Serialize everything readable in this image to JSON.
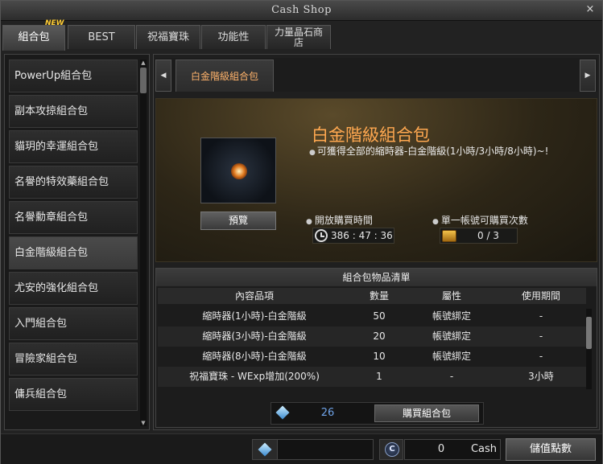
{
  "window": {
    "title": "Cash Shop",
    "close": "×"
  },
  "tabs": [
    {
      "label": "組合包",
      "badge": "NEW"
    },
    {
      "label": "BEST"
    },
    {
      "label": "祝福寶珠"
    },
    {
      "label": "功能性"
    },
    {
      "label_line1": "力量晶石商",
      "label_line2": "店"
    }
  ],
  "sidebar": {
    "items": [
      "PowerUp組合包",
      "副本攻掠組合包",
      "貓玥的幸運組合包",
      "名譽的特效藥組合包",
      "名譽勳章組合包",
      "白金階級組合包",
      "尤安的強化組合包",
      "入門組合包",
      "冒險家組合包",
      "傭兵組合包"
    ],
    "selected_index": 5
  },
  "subnav": {
    "left": "◀",
    "right": "▶",
    "tab": "白金階級組合包"
  },
  "product": {
    "title": "白金階級組合包",
    "description": "可獲得全部的縮時器-白金階級(1小時/3小時/8小時)~!",
    "preview_label": "預覽",
    "open_time_label": "開放購買時間",
    "open_time_value": "386 : 47 : 36",
    "purchase_limit_label": "單一帳號可購買次數",
    "purchase_limit_value": "0 / 3"
  },
  "item_list": {
    "title": "組合包物品清單",
    "headers": [
      "內容品項",
      "數量",
      "屬性",
      "使用期間"
    ],
    "rows": [
      [
        "縮時器(1小時)-白金階級",
        "50",
        "帳號綁定",
        "-"
      ],
      [
        "縮時器(3小時)-白金階級",
        "20",
        "帳號綁定",
        "-"
      ],
      [
        "縮時器(8小時)-白金階級",
        "10",
        "帳號綁定",
        "-"
      ],
      [
        "祝福寶珠 - WExp增加(200%)",
        "1",
        "-",
        "3小時"
      ]
    ]
  },
  "purchase": {
    "price": "26",
    "buy_label": "購買組合包"
  },
  "footer": {
    "cash_value": "0",
    "cash_label": "Cash",
    "topup_label": "儲值點數"
  },
  "colors": {
    "accent": "#ffa850",
    "price": "#6fa3e8"
  }
}
